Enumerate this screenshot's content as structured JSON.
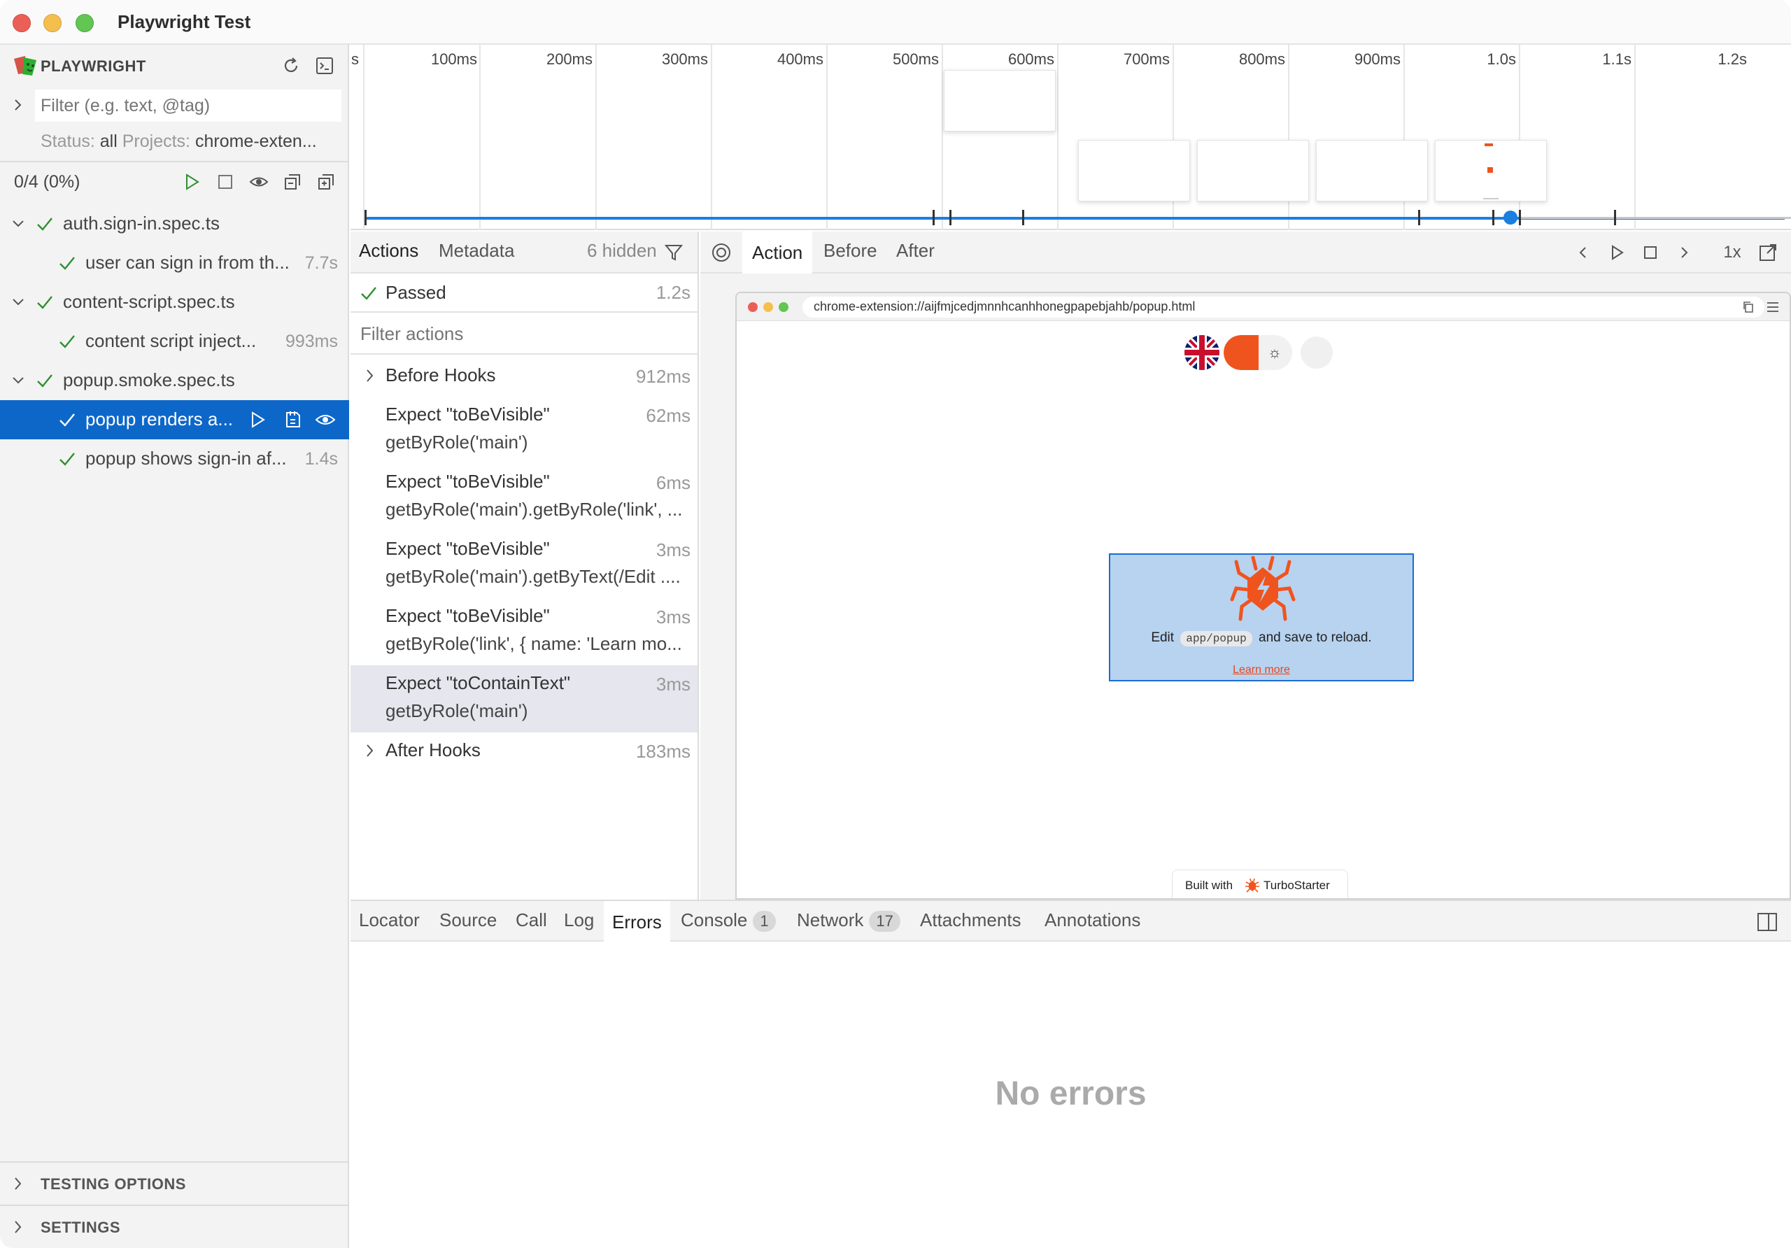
{
  "window": {
    "title": "Playwright Test"
  },
  "sidebar": {
    "brand": "PLAYWRIGHT",
    "filter_placeholder": "Filter (e.g. text, @tag)",
    "status_label": "Status:",
    "status_value": "all",
    "projects_label": "Projects:",
    "projects_value": "chrome-exten...",
    "counts": "0/4 (0%)",
    "tree": [
      {
        "label": "auth.sign-in.spec.ts",
        "kind": "file",
        "duration": ""
      },
      {
        "label": "user can sign in from th...",
        "kind": "test",
        "duration": "7.7s"
      },
      {
        "label": "content-script.spec.ts",
        "kind": "file",
        "duration": ""
      },
      {
        "label": "content script inject...",
        "kind": "test",
        "duration": "993ms"
      },
      {
        "label": "popup.smoke.spec.ts",
        "kind": "file",
        "duration": ""
      },
      {
        "label": "popup renders a...",
        "kind": "test",
        "duration": "",
        "selected": true
      },
      {
        "label": "popup shows sign-in af...",
        "kind": "test",
        "duration": "1.4s"
      }
    ],
    "testing_options": "TESTING OPTIONS",
    "settings": "SETTINGS"
  },
  "timeline": {
    "ticks": [
      "s",
      "100ms",
      "200ms",
      "300ms",
      "400ms",
      "500ms",
      "600ms",
      "700ms",
      "800ms",
      "900ms",
      "1.0s",
      "1.1s",
      "1.2s"
    ]
  },
  "actions": {
    "tabs": [
      "Actions",
      "Metadata"
    ],
    "hidden": "6 hidden",
    "passed": "Passed",
    "passed_duration": "1.2s",
    "filter_placeholder": "Filter actions",
    "before_hooks": {
      "label": "Before Hooks",
      "duration": "912ms"
    },
    "items": [
      {
        "title": "Expect \"toBeVisible\"",
        "duration": "62ms",
        "locator": "getByRole('main')"
      },
      {
        "title": "Expect \"toBeVisible\"",
        "duration": "6ms",
        "locator": "getByRole('main').getByRole('link', ..."
      },
      {
        "title": "Expect \"toBeVisible\"",
        "duration": "3ms",
        "locator": "getByRole('main').getByText(/Edit ...."
      },
      {
        "title": "Expect \"toBeVisible\"",
        "duration": "3ms",
        "locator": "getByRole('link', { name: 'Learn mo..."
      },
      {
        "title": "Expect \"toContainText\"",
        "duration": "3ms",
        "locator": "getByRole('main')"
      }
    ],
    "after_hooks": {
      "label": "After Hooks",
      "duration": "183ms"
    }
  },
  "snapshot": {
    "tabs": [
      "Action",
      "Before",
      "After"
    ],
    "speed": "1x",
    "url": "chrome-extension://aijfmjcedjmnnhcanhhonegpapebjahb/popup.html",
    "edit_prefix": "Edit",
    "edit_code": "app/popup",
    "edit_suffix": "and save to reload.",
    "learn_more": "Learn more",
    "built_with": "Built with",
    "built_brand": "TurboStarter"
  },
  "bottom": {
    "tabs": [
      {
        "label": "Locator"
      },
      {
        "label": "Source"
      },
      {
        "label": "Call"
      },
      {
        "label": "Log"
      },
      {
        "label": "Errors",
        "active": true
      },
      {
        "label": "Console",
        "badge": "1"
      },
      {
        "label": "Network",
        "badge": "17"
      },
      {
        "label": "Attachments"
      },
      {
        "label": "Annotations"
      }
    ],
    "empty_message": "No errors"
  },
  "colors": {
    "accent": "#0d67c9",
    "pass": "#2f8f2f",
    "brand_orange": "#f0541e",
    "highlight_box": "#b7d3f0"
  }
}
